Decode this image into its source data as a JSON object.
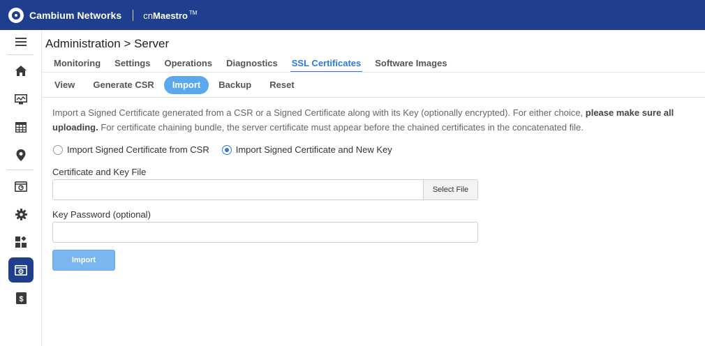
{
  "topbar": {
    "brand": "Cambium Networks",
    "product_prefix": "cn",
    "product_name": "Maestro",
    "trademark": "TM"
  },
  "sidebar": {
    "items": [
      {
        "icon": "hamburger-menu-icon"
      },
      {
        "icon": "home-icon"
      },
      {
        "icon": "monitor-icon"
      },
      {
        "icon": "grid-table-icon"
      },
      {
        "icon": "location-pin-icon"
      },
      {
        "icon": "dashboard-window-icon"
      },
      {
        "icon": "gear-icon"
      },
      {
        "icon": "apps-icon"
      },
      {
        "icon": "administration-icon",
        "active": true
      },
      {
        "icon": "dollar-icon"
      }
    ]
  },
  "page": {
    "title": "Administration > Server"
  },
  "tabs": {
    "primary": [
      {
        "label": "Monitoring"
      },
      {
        "label": "Settings"
      },
      {
        "label": "Operations"
      },
      {
        "label": "Diagnostics"
      },
      {
        "label": "SSL Certificates",
        "active": true
      },
      {
        "label": "Software Images"
      }
    ],
    "secondary": [
      {
        "label": "View"
      },
      {
        "label": "Generate CSR"
      },
      {
        "label": "Import",
        "active": true
      },
      {
        "label": "Backup"
      },
      {
        "label": "Reset"
      }
    ]
  },
  "content": {
    "desc_line1_normal": "Import a Signed Certificate generated from a CSR or a Signed Certificate along with its Key (optionally encrypted). For either choice, ",
    "desc_line1_bold": "please make sure all",
    "desc_line2_bold": "uploading.",
    "desc_line2_normal": " For certificate chaining bundle, the server certificate must appear before the chained certificates in the concatenated file.",
    "radio_options": [
      {
        "label": "Import Signed Certificate from CSR",
        "selected": false
      },
      {
        "label": "Import Signed Certificate and New Key",
        "selected": true
      }
    ],
    "cert_file_label": "Certificate and Key File",
    "cert_file_value": "",
    "select_file_button": "Select File",
    "key_password_label": "Key Password (optional)",
    "key_password_value": "",
    "import_button": "Import"
  },
  "colors": {
    "topbar": "#1f3f8e",
    "accent": "#2a7ae2",
    "pill_active": "#5aa8ee",
    "import_button": "#7ab6f0"
  }
}
